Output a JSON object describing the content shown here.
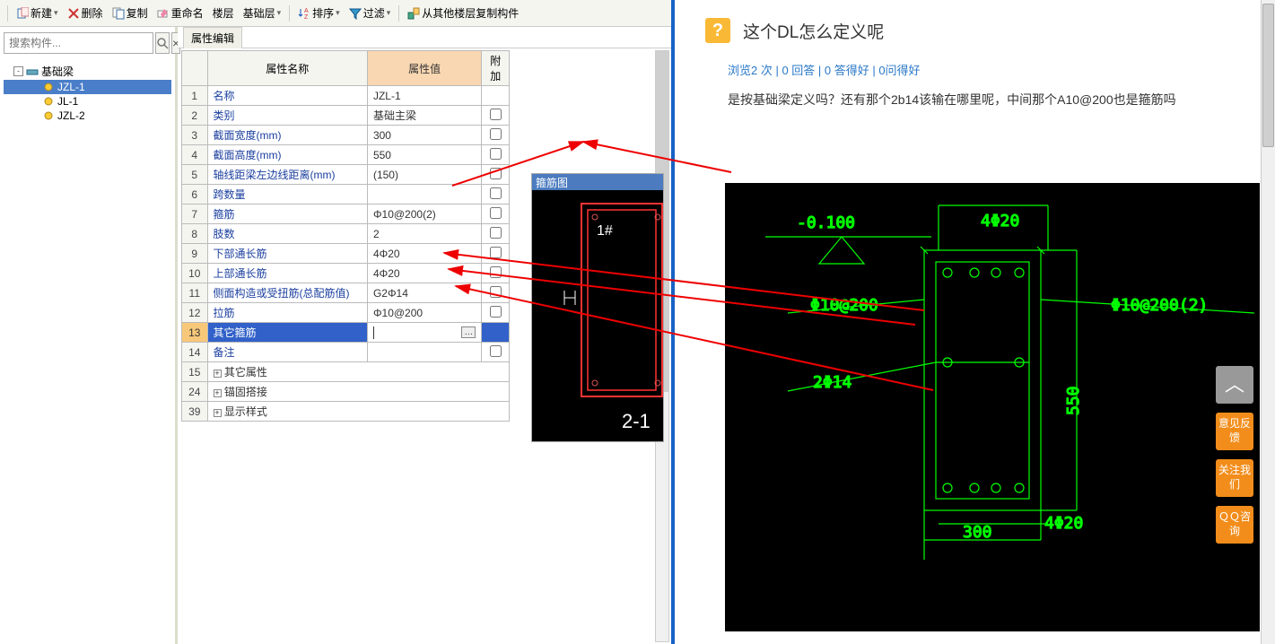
{
  "toolbar": {
    "new": "新建",
    "delete": "删除",
    "copy": "复制",
    "rename": "重命名",
    "floor": "楼层",
    "floorCombo": "基础层",
    "sort": "排序",
    "filter": "过滤",
    "copyFromOther": "从其他楼层复制构件"
  },
  "search": {
    "placeholder": "搜索构件..."
  },
  "tree": {
    "root": "基础梁",
    "items": [
      "JZL-1",
      "JL-1",
      "JZL-2"
    ]
  },
  "prop": {
    "tab": "属性编辑",
    "headers": {
      "name": "属性名称",
      "value": "属性值",
      "extra": "附加"
    },
    "rows": [
      {
        "n": "1",
        "name": "名称",
        "value": "JZL-1",
        "chk": false,
        "blue": true
      },
      {
        "n": "2",
        "name": "类别",
        "value": "基础主梁",
        "chk": true,
        "blue": true
      },
      {
        "n": "3",
        "name": "截面宽度(mm)",
        "value": "300",
        "chk": true,
        "blue": true
      },
      {
        "n": "4",
        "name": "截面高度(mm)",
        "value": "550",
        "chk": true,
        "blue": true
      },
      {
        "n": "5",
        "name": "轴线距梁左边线距离(mm)",
        "value": "(150)",
        "chk": true,
        "blue": true
      },
      {
        "n": "6",
        "name": "跨数量",
        "value": "",
        "chk": true,
        "blue": true
      },
      {
        "n": "7",
        "name": "箍筋",
        "value": "Φ10@200(2)",
        "chk": true,
        "blue": true
      },
      {
        "n": "8",
        "name": "肢数",
        "value": "2",
        "chk": true,
        "blue": true
      },
      {
        "n": "9",
        "name": "下部通长筋",
        "value": "4Φ20",
        "chk": true,
        "blue": true
      },
      {
        "n": "10",
        "name": "上部通长筋",
        "value": "4Φ20",
        "chk": true,
        "blue": true
      },
      {
        "n": "11",
        "name": "侧面构造或受扭筋(总配筋值)",
        "value": "G2Φ14",
        "chk": true,
        "blue": true
      },
      {
        "n": "12",
        "name": "拉筋",
        "value": "Φ10@200",
        "chk": true,
        "blue": true
      },
      {
        "n": "13",
        "name": "其它箍筋",
        "value": "",
        "chk": false,
        "blue": true,
        "sel": true
      },
      {
        "n": "14",
        "name": "备注",
        "value": "",
        "chk": true,
        "blue": true
      }
    ],
    "groups": [
      {
        "n": "15",
        "name": "其它属性"
      },
      {
        "n": "24",
        "name": "锚固搭接"
      },
      {
        "n": "39",
        "name": "显示样式"
      }
    ]
  },
  "miniDwg": {
    "title": "箍筋图",
    "label1": "1#",
    "label2": "2-1"
  },
  "question": {
    "title": "这个DL怎么定义呢",
    "stats": "浏览2 次 | 0 回答 | 0 答得好 | 0问得好",
    "body": "是按基础梁定义吗？还有那个2b14该输在哪里呢，中间那个A10@200也是箍筋吗"
  },
  "sideBtns": {
    "top": "︿",
    "fb": "意见反馈",
    "follow": "关注我们",
    "qq": "ＱＱ咨询"
  },
  "chart_data": {
    "type": "cad-section",
    "elevation": "-0.100",
    "top_bars": "4Φ20",
    "bottom_bars": "4Φ20",
    "stirrup_outer": "Φ10@200(2)",
    "stirrup_inner": "Φ10@200",
    "side_bars": "2Φ14",
    "width_mm": 300,
    "height_mm": 550
  }
}
